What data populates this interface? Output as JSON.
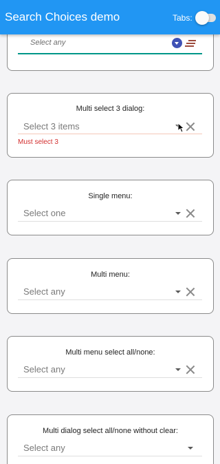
{
  "appbar": {
    "title": "Search Choices demo",
    "tabs_label": "Tabs:",
    "tabs_enabled": false
  },
  "top_card": {
    "placeholder": "Select any"
  },
  "cards": [
    {
      "title": "Multi select 3 dialog:",
      "placeholder": "Select 3 items",
      "error": "Must select 3"
    },
    {
      "title": "Single menu:",
      "placeholder": "Select one"
    },
    {
      "title": "Multi menu:",
      "placeholder": "Select any"
    },
    {
      "title": "Multi menu select all/none:",
      "placeholder": "Select any"
    },
    {
      "title": "Multi dialog select all/none without clear:",
      "placeholder": "Select any"
    }
  ],
  "colors": {
    "primary": "#2196f3",
    "accent_teal": "#009688",
    "indigo": "#3f51b5",
    "error": "#d32f2f"
  }
}
